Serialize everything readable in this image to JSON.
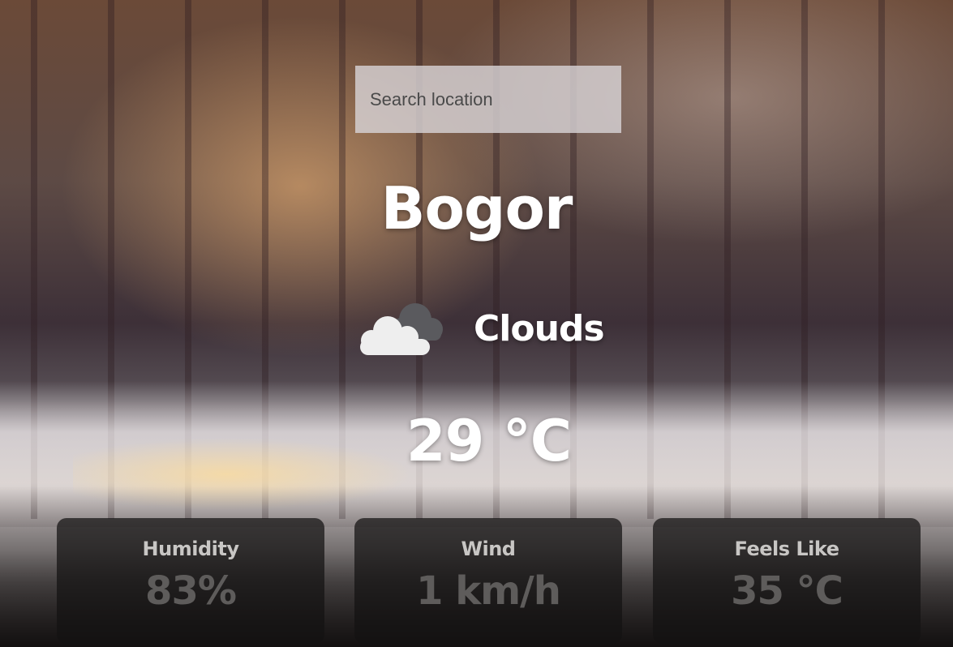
{
  "search": {
    "placeholder": "Search location",
    "value": ""
  },
  "weather": {
    "city": "Bogor",
    "condition": "Clouds",
    "condition_icon": "cloud-icon",
    "temperature": "29 °C"
  },
  "details": [
    {
      "label": "Humidity",
      "value": "83%"
    },
    {
      "label": "Wind",
      "value": "1 km/h"
    },
    {
      "label": "Feels Like",
      "value": "35 °C"
    }
  ]
}
